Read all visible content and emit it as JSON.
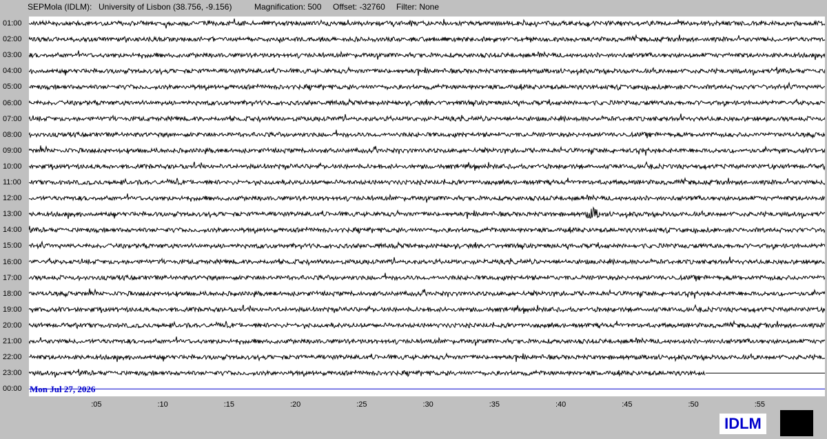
{
  "header": {
    "station": "SEPMola (IDLM):",
    "location": "University of Lisbon (38.756, -9.156)",
    "magnification": "Magnification: 500",
    "offset": "Offset: -32760",
    "filter": "Filter: None"
  },
  "hour_labels": [
    "01:00",
    "02:00",
    "03:00",
    "04:00",
    "05:00",
    "06:00",
    "07:00",
    "08:00",
    "09:00",
    "10:00",
    "11:00",
    "12:00",
    "13:00",
    "14:00",
    "15:00",
    "16:00",
    "17:00",
    "18:00",
    "19:00",
    "20:00",
    "21:00",
    "22:00",
    "23:00",
    "00:00"
  ],
  "minute_labels": [
    ":05",
    ":10",
    ":15",
    ":20",
    ":25",
    ":30",
    ":35",
    ":40",
    ":45",
    ":50",
    ":55"
  ],
  "date": "Mon Jul 27, 2026",
  "station_code": "IDLM",
  "colors": {
    "background": "#c0c0c0",
    "plot": "#ffffff",
    "trace": "#000000",
    "accent": "#0000cc"
  },
  "helicorder": {
    "trace_count": 23,
    "last_trace_end_minute": 51,
    "event_row": 13,
    "event_minute": 42.5
  }
}
